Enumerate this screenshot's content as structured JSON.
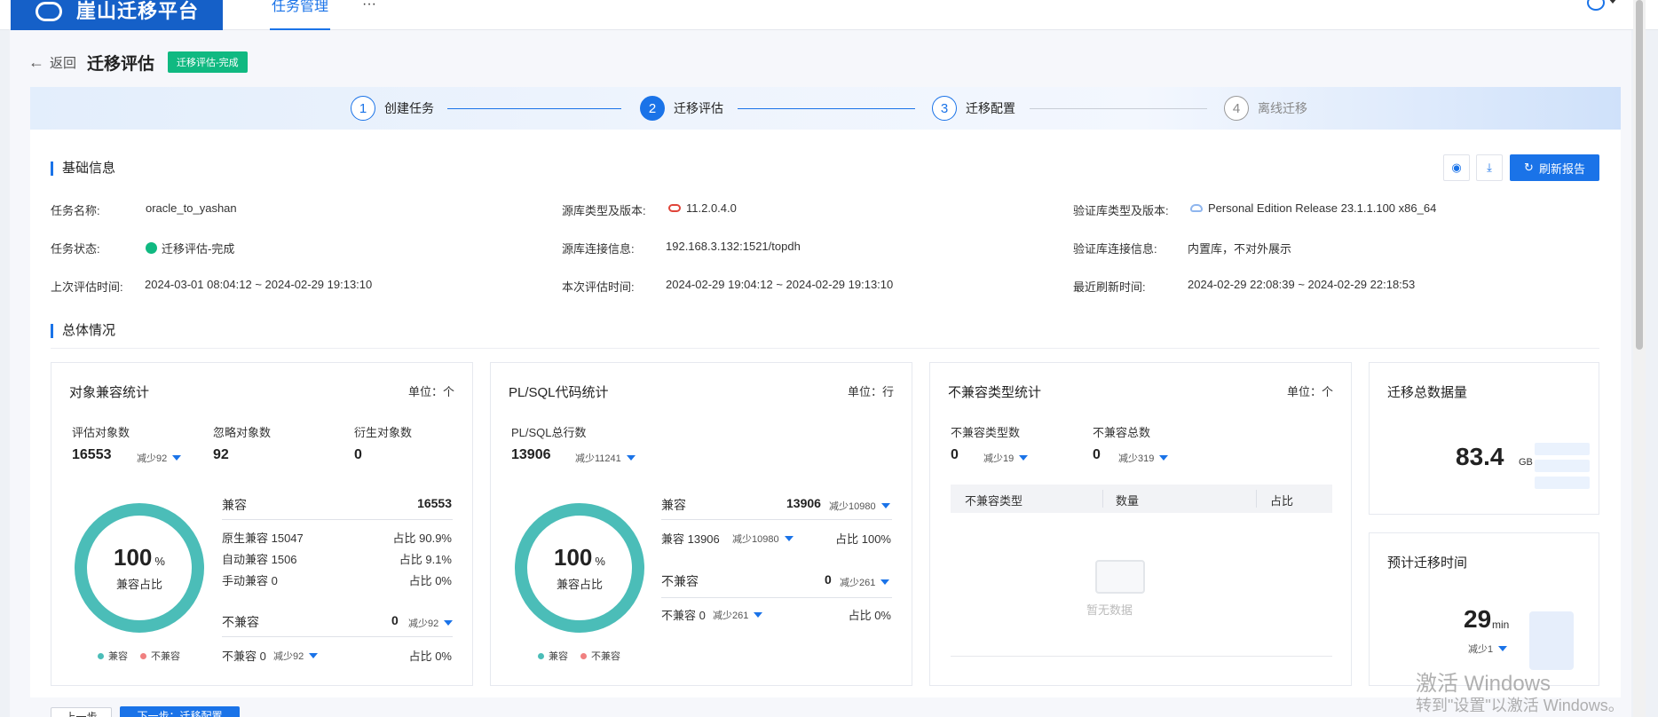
{
  "header": {
    "app_name": "崖山迁移平台",
    "nav_tab": "任务管理",
    "nav_more": "···"
  },
  "page": {
    "back_label": "返回",
    "title": "迁移评估",
    "status_tag": "迁移评估-完成"
  },
  "steps": [
    {
      "num": "1",
      "label": "创建任务"
    },
    {
      "num": "2",
      "label": "迁移评估"
    },
    {
      "num": "3",
      "label": "迁移配置"
    },
    {
      "num": "4",
      "label": "离线迁移"
    }
  ],
  "basic_info": {
    "section_title": "基础信息",
    "refresh_label": "刷新报告",
    "task_name_label": "任务名称:",
    "task_name": "oracle_to_yashan",
    "source_type_label": "源库类型及版本:",
    "source_type": "11.2.0.4.0",
    "verify_type_label": "验证库类型及版本:",
    "verify_type": "Personal Edition Release 23.1.1.100 x86_64",
    "task_status_label": "任务状态:",
    "task_status": "迁移评估-完成",
    "source_conn_label": "源库连接信息:",
    "source_conn": "192.168.3.132:1521/topdh",
    "verify_conn_label": "验证库连接信息:",
    "verify_conn": "内置库，不对外展示",
    "last_eval_label": "上次评估时间:",
    "last_eval": "2024-03-01 08:04:12 ~ 2024-02-29 19:13:10",
    "this_eval_label": "本次评估时间:",
    "this_eval": "2024-02-29 19:04:12 ~ 2024-02-29 19:13:10",
    "recent_refresh_label": "最近刷新时间:",
    "recent_refresh": "2024-02-29 22:08:39 ~ 2024-02-29 22:18:53"
  },
  "overview": {
    "section_title": "总体情况",
    "object_stats": {
      "title": "对象兼容统计",
      "unit": "单位：个",
      "eval_label": "评估对象数",
      "eval_value": "16553",
      "eval_delta": "减少92",
      "ignore_label": "忽略对象数",
      "ignore_value": "92",
      "derived_label": "衍生对象数",
      "derived_value": "0",
      "donut_value": "100",
      "donut_percent": "%",
      "donut_label": "兼容占比",
      "compatible_percent": 100,
      "compat_label": "兼容",
      "compat_value": "16553",
      "native_label": "原生兼容 15047",
      "native_ratio": "占比 90.9%",
      "auto_label": "自动兼容 1506",
      "auto_ratio": "占比 9.1%",
      "manual_label": "手动兼容 0",
      "manual_ratio": "占比 0%",
      "incompat_label": "不兼容",
      "incompat_value": "0",
      "incompat_delta": "减少92",
      "incompat2_label": "不兼容 0",
      "incompat2_delta": "减少92",
      "incompat2_ratio": "占比 0%",
      "legend_compat": "兼容",
      "legend_incompat": "不兼容"
    },
    "plsql_stats": {
      "title": "PL/SQL代码统计",
      "unit": "单位：行",
      "total_label": "PL/SQL总行数",
      "total_value": "13906",
      "total_delta": "减少11241",
      "donut_value": "100",
      "donut_percent": "%",
      "donut_label": "兼容占比",
      "compatible_percent": 100,
      "compat_label": "兼容",
      "compat_value": "13906",
      "compat_delta": "减少10980",
      "compat2_label": "兼容 13906",
      "compat2_delta": "减少10980",
      "compat2_ratio": "占比 100%",
      "incompat_label": "不兼容",
      "incompat_value": "0",
      "incompat_delta": "减少261",
      "incompat2_label": "不兼容 0",
      "incompat2_delta": "减少261",
      "incompat2_ratio": "占比 0%",
      "legend_compat": "兼容",
      "legend_incompat": "不兼容"
    },
    "incompat_stats": {
      "title": "不兼容类型统计",
      "unit": "单位：个",
      "type_count_label": "不兼容类型数",
      "type_count_value": "0",
      "type_count_delta": "减少19",
      "total_label": "不兼容总数",
      "total_value": "0",
      "total_delta": "减少319",
      "col_type": "不兼容类型",
      "col_count": "数量",
      "col_ratio": "占比",
      "empty_text": "暂无数据"
    },
    "total_data": {
      "title": "迁移总数据量",
      "value": "83.4",
      "unit": "GB"
    },
    "est_time": {
      "title": "预计迁移时间",
      "value": "29",
      "unit": "min",
      "delta": "减少1"
    }
  },
  "footer": {
    "prev_label": "上一步",
    "next_label": "下一步：迁移配置"
  },
  "watermark": {
    "line1": "激活 Windows",
    "line2": "转到\"设置\"以激活 Windows。"
  },
  "colors": {
    "accent": "#1a73e8",
    "logo_bg": "#1560c8",
    "success": "#10b981",
    "donut": "#4bbdb8",
    "incompat_dot": "#f08080"
  }
}
